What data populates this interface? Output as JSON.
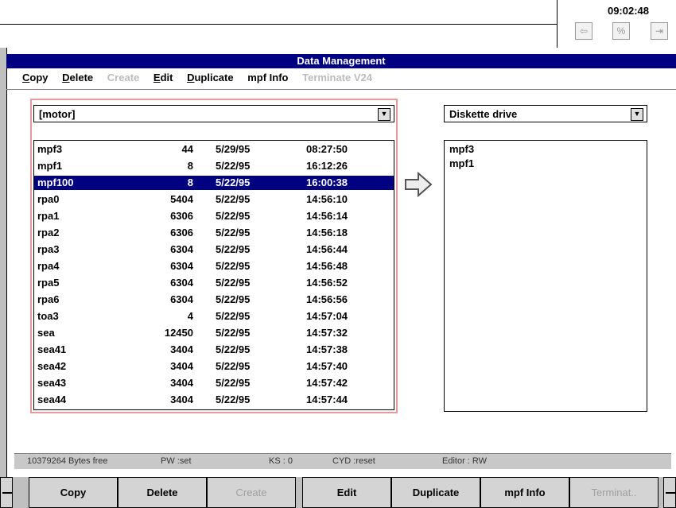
{
  "header": {
    "clock": "09:02:48"
  },
  "window": {
    "title": "Data Management"
  },
  "menu": [
    {
      "underline": "C",
      "rest": "opy",
      "enabled": true
    },
    {
      "underline": "D",
      "rest": "elete",
      "enabled": true
    },
    {
      "underline": "",
      "rest": "Create",
      "enabled": false
    },
    {
      "underline": "E",
      "rest": "dit",
      "enabled": true
    },
    {
      "underline": "D",
      "rest": "uplicate",
      "enabled": true
    },
    {
      "underline": "",
      "rest": "mpf Info",
      "enabled": true
    },
    {
      "underline": "",
      "rest": "Terminate V24",
      "enabled": false
    }
  ],
  "source": {
    "selected": "[motor]",
    "rows": [
      {
        "name": "mpf3",
        "size": "44",
        "date": "5/29/95",
        "time": "08:27:50",
        "selected": false
      },
      {
        "name": "mpf1",
        "size": "8",
        "date": "5/22/95",
        "time": "16:12:26",
        "selected": false
      },
      {
        "name": "mpf100",
        "size": "8",
        "date": "5/22/95",
        "time": "16:00:38",
        "selected": true
      },
      {
        "name": "rpa0",
        "size": "5404",
        "date": "5/22/95",
        "time": "14:56:10",
        "selected": false
      },
      {
        "name": "rpa1",
        "size": "6306",
        "date": "5/22/95",
        "time": "14:56:14",
        "selected": false
      },
      {
        "name": "rpa2",
        "size": "6306",
        "date": "5/22/95",
        "time": "14:56:18",
        "selected": false
      },
      {
        "name": "rpa3",
        "size": "6304",
        "date": "5/22/95",
        "time": "14:56:44",
        "selected": false
      },
      {
        "name": "rpa4",
        "size": "6304",
        "date": "5/22/95",
        "time": "14:56:48",
        "selected": false
      },
      {
        "name": "rpa5",
        "size": "6304",
        "date": "5/22/95",
        "time": "14:56:52",
        "selected": false
      },
      {
        "name": "rpa6",
        "size": "6304",
        "date": "5/22/95",
        "time": "14:56:56",
        "selected": false
      },
      {
        "name": "toa3",
        "size": "4",
        "date": "5/22/95",
        "time": "14:57:04",
        "selected": false
      },
      {
        "name": "sea",
        "size": "12450",
        "date": "5/22/95",
        "time": "14:57:32",
        "selected": false
      },
      {
        "name": "sea41",
        "size": "3404",
        "date": "5/22/95",
        "time": "14:57:38",
        "selected": false
      },
      {
        "name": "sea42",
        "size": "3404",
        "date": "5/22/95",
        "time": "14:57:40",
        "selected": false
      },
      {
        "name": "sea43",
        "size": "3404",
        "date": "5/22/95",
        "time": "14:57:42",
        "selected": false
      },
      {
        "name": "sea44",
        "size": "3404",
        "date": "5/22/95",
        "time": "14:57:44",
        "selected": false
      }
    ]
  },
  "target": {
    "selected": "Diskette drive",
    "items": [
      "mpf3",
      "mpf1"
    ]
  },
  "status": {
    "free": "10379264 Bytes free",
    "pw": "PW :set",
    "ks": "KS : 0",
    "cyd": "CYD :reset",
    "editor": "Editor : RW"
  },
  "softkeys": [
    {
      "label": "Copy",
      "enabled": true
    },
    {
      "label": "Delete",
      "enabled": true
    },
    {
      "label": "Create",
      "enabled": false
    },
    {
      "label": "Edit",
      "enabled": true
    },
    {
      "label": "Duplicate",
      "enabled": true
    },
    {
      "label": "mpf Info",
      "enabled": true
    },
    {
      "label": "Terminat..",
      "enabled": false
    }
  ],
  "icons": [
    "exit-icon",
    "percent-icon",
    "logout-icon",
    "arrow-right-icon",
    "dropdown-arrow-icon"
  ],
  "colors": {
    "titlebar": "#000080",
    "selection": "#000080",
    "panel_border": "#e89a9a"
  }
}
